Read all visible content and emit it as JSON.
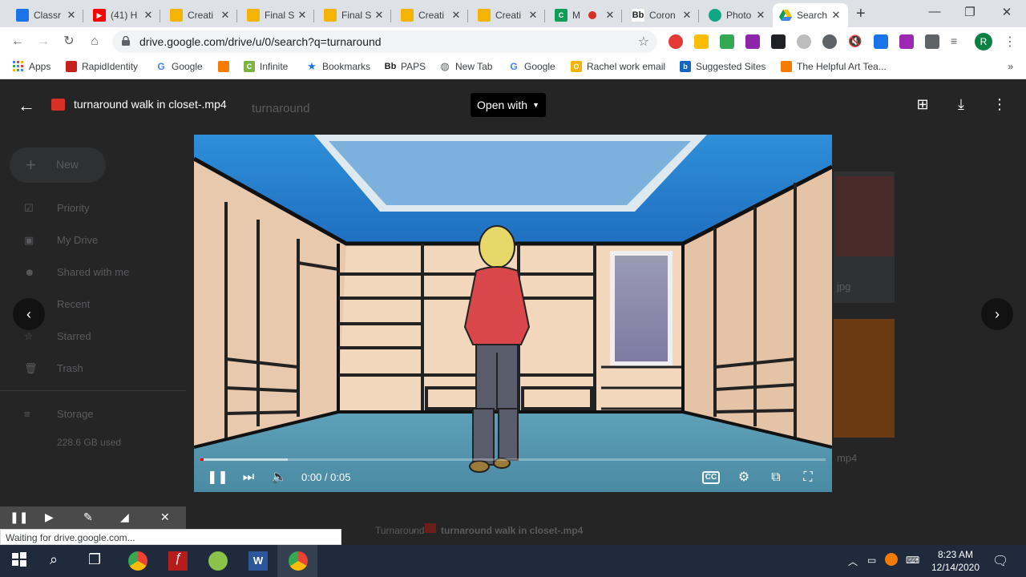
{
  "browser": {
    "tabs": [
      {
        "label": "Classr",
        "fav_color": "#1a73e8",
        "fav_text": ""
      },
      {
        "label": "(41) H",
        "fav_color": "#ff0000",
        "fav_text": "▶"
      },
      {
        "label": "Creati",
        "fav_color": "#f4b400",
        "fav_text": ""
      },
      {
        "label": "Final S",
        "fav_color": "#f4b400",
        "fav_text": ""
      },
      {
        "label": "Final S",
        "fav_color": "#f4b400",
        "fav_text": ""
      },
      {
        "label": "Creati",
        "fav_color": "#f4b400",
        "fav_text": ""
      },
      {
        "label": "Creati",
        "fav_color": "#f4b400",
        "fav_text": ""
      },
      {
        "label": "M",
        "fav_color": "#0f9d58",
        "fav_text": "C"
      },
      {
        "label": "Coron",
        "fav_color": "#202124",
        "fav_text": "Bb"
      },
      {
        "label": "Photo",
        "fav_color": "#11a683",
        "fav_text": ""
      },
      {
        "label": "Search",
        "fav_color": "#ffffff",
        "fav_text": ""
      }
    ],
    "url": "drive.google.com/drive/u/0/search?q=turnaround",
    "profile_initial": "R",
    "bookmarks": [
      {
        "label": "Apps",
        "color": "#ea4335"
      },
      {
        "label": "RapidIdentity",
        "color": "#c5221f"
      },
      {
        "label": "Google",
        "color": "#4285f4"
      },
      {
        "label": "",
        "color": "#f57c00"
      },
      {
        "label": "Infinite",
        "color": "#7cb342"
      },
      {
        "label": "Bookmarks",
        "color": "#1a73e8"
      },
      {
        "label": "PAPS",
        "color": "#202124"
      },
      {
        "label": "New Tab",
        "color": "#5f6368"
      },
      {
        "label": "Google",
        "color": "#4285f4"
      },
      {
        "label": "Rachel work email",
        "color": "#f4b400"
      },
      {
        "label": "Suggested Sites",
        "color": "#1565c0"
      },
      {
        "label": "The Helpful Art Tea...",
        "color": "#f57c00"
      }
    ],
    "bookmarks_more": "»"
  },
  "viewer": {
    "file_title": "turnaround walk in closet-.mp4",
    "open_with_label": "Open with",
    "timecode": "0:00 / 0:05",
    "progress": {
      "played": 0.005,
      "buffered": 0.14
    }
  },
  "drive_bg": {
    "search_text": "turnaround",
    "new_label": "New",
    "nav": [
      "Priority",
      "My Drive",
      "Shared with me",
      "Recent",
      "Starred",
      "Trash"
    ],
    "storage_label": "Storage",
    "storage_used": "228.6 GB used",
    "breadcrumb_folder": "Turnaround",
    "breadcrumb_file": "turnaround walk in closet-.mp4",
    "thumb_label_1": "jpg",
    "thumb_label_2": "mp4"
  },
  "status_text": "Waiting for drive.google.com...",
  "taskbar": {
    "time": "8:23 AM",
    "date": "12/14/2020"
  }
}
